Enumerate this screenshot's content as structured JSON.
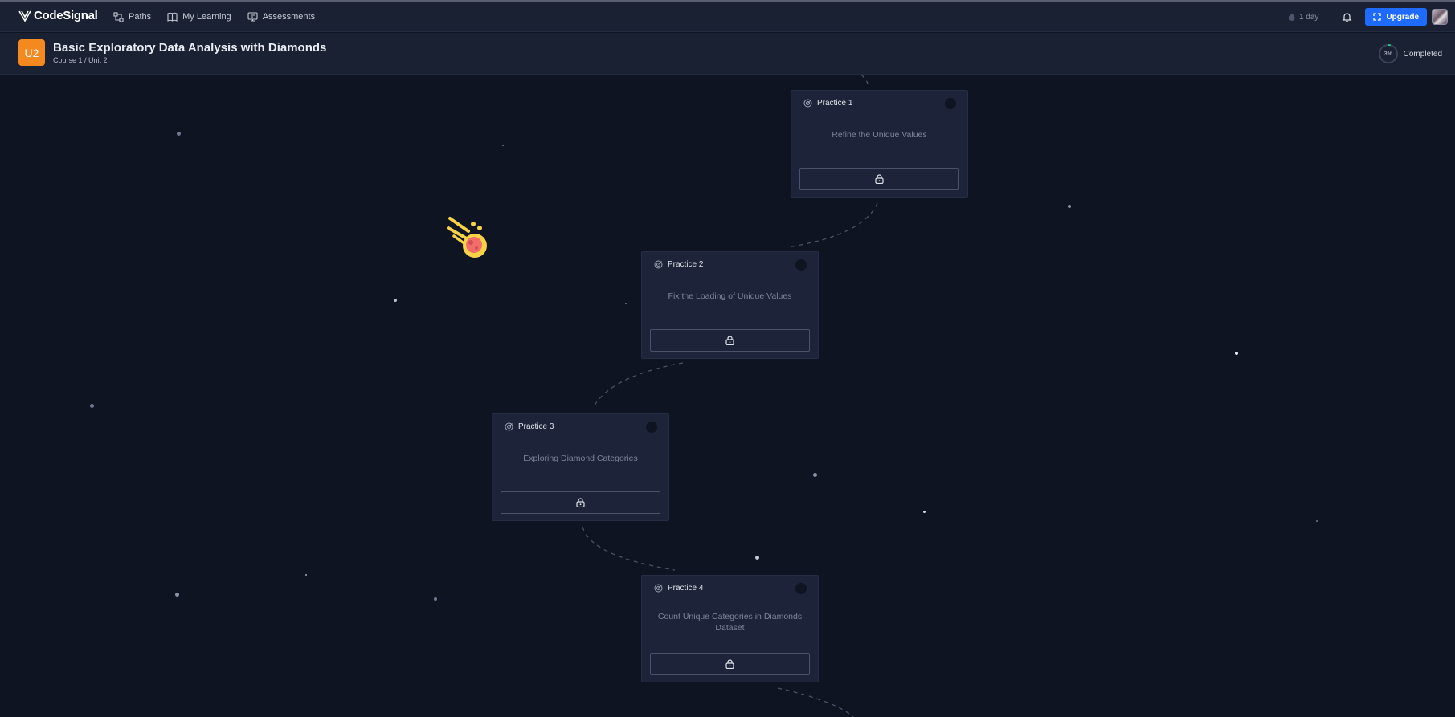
{
  "navbar": {
    "logo_text": "CodeSignal",
    "links": [
      {
        "label": "Paths",
        "icon": "paths-icon"
      },
      {
        "label": "My Learning",
        "icon": "book-icon"
      },
      {
        "label": "Assessments",
        "icon": "assessment-icon"
      }
    ],
    "streak_label": "1 day",
    "upgrade_label": "Upgrade"
  },
  "course": {
    "badge": "U2",
    "title": "Basic Exploratory Data Analysis with Diamonds",
    "subtitle": "Course 1 / Unit 2",
    "progress_percent": "3%",
    "progress_fraction": 0.03,
    "progress_label": "Completed"
  },
  "practices": [
    {
      "label": "Practice 1",
      "title": "Refine the Unique Values",
      "locked": true
    },
    {
      "label": "Practice 2",
      "title": "Fix the Loading of Unique Values",
      "locked": true
    },
    {
      "label": "Practice 3",
      "title": "Exploring Diamond Categories",
      "locked": true
    },
    {
      "label": "Practice 4",
      "title": "Count Unique Categories in Diamonds Dataset",
      "locked": true
    }
  ],
  "colors": {
    "background": "#0f1422",
    "panel": "#1a2133",
    "card": "#1d2439",
    "accent_blue": "#1f6bff",
    "badge_orange": "#f48a1f"
  }
}
